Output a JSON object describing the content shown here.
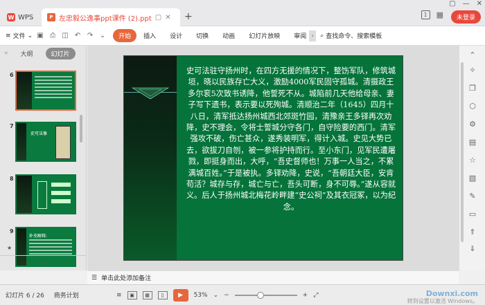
{
  "titlebar": {
    "app_name": "WPS",
    "doc_name": "左忠毅公逸事ppt课件 (2).ppt",
    "login_label": "未登录",
    "badge": "1"
  },
  "menubar": {
    "file_label": "文件",
    "start_label": "开始",
    "tabs": [
      "插入",
      "设计",
      "切换",
      "动画",
      "幻灯片放映",
      "审阅"
    ],
    "search_label": "查找命令、搜索模板"
  },
  "leftpanel": {
    "tab_outline": "大纲",
    "tab_slides": "幻灯片",
    "thumbs": [
      {
        "num": "6"
      },
      {
        "num": "7",
        "title": "史可法像"
      },
      {
        "num": "8"
      },
      {
        "num": "9",
        "title": "补充解释:"
      }
    ]
  },
  "slide": {
    "text": "史可法驻守扬州时，在四方无援的情况下，整饬军队，修筑城垣，晓以民族存亡大义，激励4000军民固守孤城。清摄政王多尔衮5次致书诱降，他誓死不从。城陷前几天他给母亲、妻子写下遗书，表示要以死殉城。清顺治二年（1645）四月十八日，清军抵达扬州城西北郊斑竹园，清豫亲王多铎再次劝降，史不理会，令将士誓城分守各门，自守险要的西门。清军强攻不破，伤亡甚众，遂秀装明军，得计入城。史见大势已去，欲拔刀自刎，被一参将护持而行。至小东门，见军民遭屠戮，即挺身而出，大呼，“吾史督师也！万事一人当之，不累满城百姓。”于是被执。多铎劝降，史说，“吾朝廷大臣，安肯苟活？城存与存，城亡与亡，吾头可断，身不可辱。”遂从容就义。后人于扬州城北梅花岭畔建“史公祠”及其衣冠冢，以为纪念。"
  },
  "notes": {
    "placeholder": "单击此处添加备注"
  },
  "statusbar": {
    "slide_counter": "幻灯片 6 / 26",
    "theme": "商务计划",
    "zoom": "53%",
    "zoom_fraction": 0.42,
    "activate": "转到设置以激活 Windows。",
    "watermark": "Downxi.com"
  }
}
